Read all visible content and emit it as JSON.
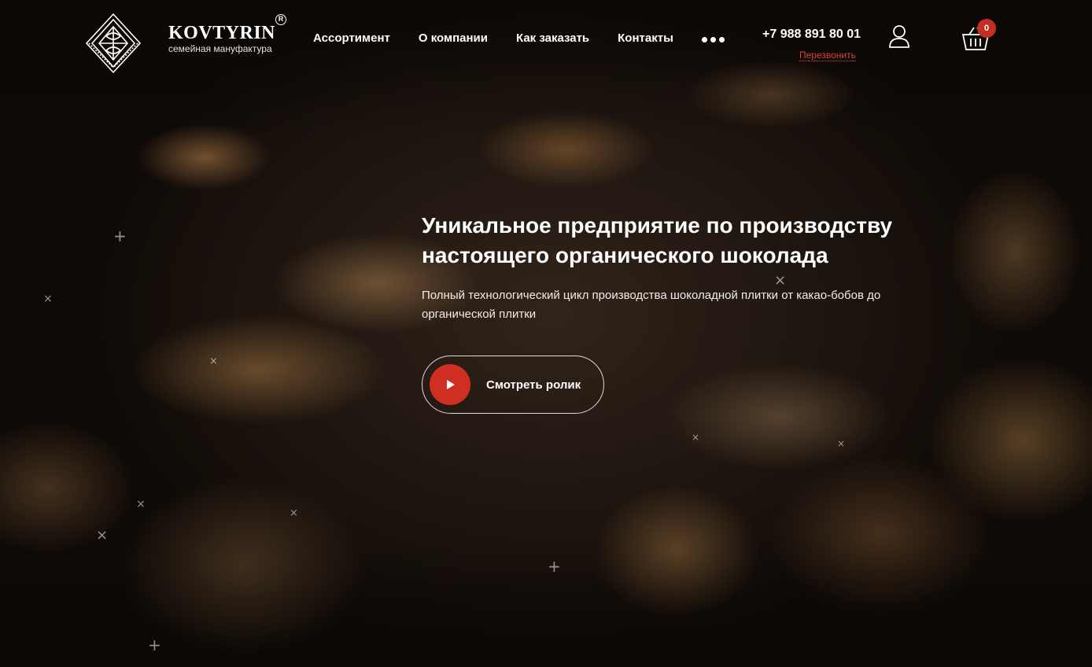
{
  "brand": {
    "name": "KOVTYRIN",
    "registered_mark": "R",
    "tagline": "семейная мануфактура"
  },
  "nav": {
    "items": [
      {
        "label": "Ассортимент"
      },
      {
        "label": "О компании"
      },
      {
        "label": "Как заказать"
      },
      {
        "label": "Контакты"
      }
    ],
    "more_icon": "more-dots-icon"
  },
  "contact": {
    "phone": "+7 988 891 80 01",
    "callback_label": "Перезвонить"
  },
  "user": {
    "icon": "user-icon"
  },
  "cart": {
    "icon": "cart-icon",
    "count": "0"
  },
  "hero": {
    "title_line1": "Уникальное предприятие по производству",
    "title_line2": "настоящего органического шоколада",
    "description": "Полный технологический цикл производства шоколадной плитки от какао-бобов до органической плитки",
    "video_button_label": "Смотреть ролик",
    "play_icon": "play-icon"
  },
  "colors": {
    "accent": "#cf2f22",
    "badge": "#c42e23",
    "callback_link": "#d9442e",
    "text": "#ffffff"
  }
}
